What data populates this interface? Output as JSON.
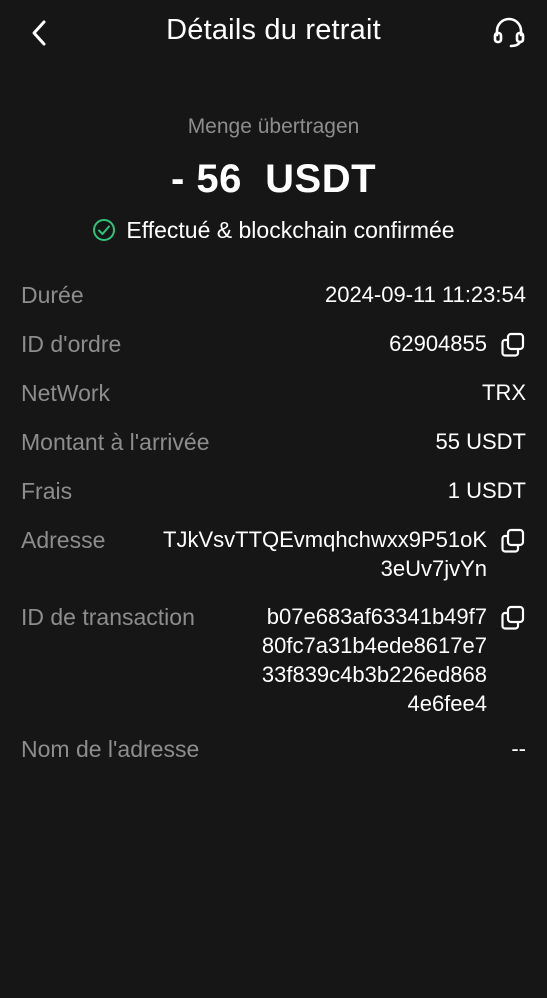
{
  "header": {
    "title": "Détails du retrait",
    "back_icon": "chevron-left-icon",
    "support_icon": "headset-icon"
  },
  "summary": {
    "amount_label": "Menge übertragen",
    "amount": "- 56  USDT",
    "status_text": "Effectué & blockchain confirmée",
    "status_icon": "check-circle-icon",
    "status_color": "#2ec47a"
  },
  "details": {
    "duration": {
      "label": "Durée",
      "value": "2024-09-11 11:23:54"
    },
    "order_id": {
      "label": "ID d'ordre",
      "value": "62904855"
    },
    "network": {
      "label": "NetWork",
      "value": "TRX"
    },
    "arrival_amount": {
      "label": "Montant à l'arrivée",
      "value": "55 USDT"
    },
    "fee": {
      "label": "Frais",
      "value": "1 USDT"
    },
    "address": {
      "label": "Adresse",
      "value": "TJkVsvTTQEvmqhchwxx9P51oK\n3eUv7jvYn"
    },
    "tx_id": {
      "label": "ID de transaction",
      "value": "b07e683af63341b49f7\n80fc7a31b4ede8617e7\n33f839c4b3b226ed868\n4e6fee4"
    },
    "address_name": {
      "label": "Nom de l'adresse",
      "value": "--"
    }
  },
  "colors": {
    "background": "#161616",
    "label": "#8d8d8d",
    "text": "#ffffff",
    "success": "#2ec47a"
  }
}
